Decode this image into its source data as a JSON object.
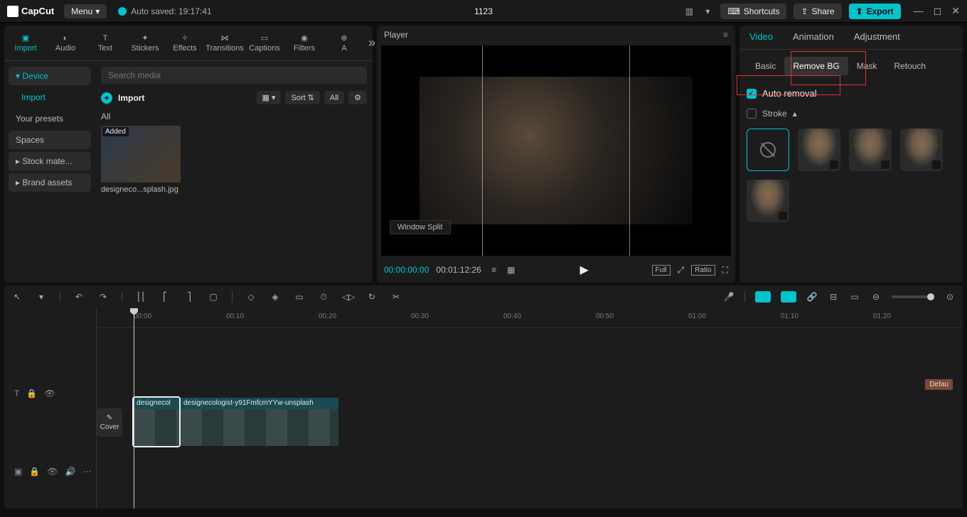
{
  "app": {
    "name": "CapCut",
    "menu": "Menu",
    "autosave": "Auto saved: 19:17:41",
    "project": "1123"
  },
  "topbuttons": {
    "shortcuts": "Shortcuts",
    "share": "Share",
    "export": "Export"
  },
  "mediaTabs": [
    "Import",
    "Audio",
    "Text",
    "Stickers",
    "Effects",
    "Transitions",
    "Captions",
    "Filters",
    "A"
  ],
  "sidebar": {
    "device": "Device",
    "import": "Import",
    "presets": "Your presets",
    "spaces": "Spaces",
    "stock": "Stock mate...",
    "brand": "Brand assets"
  },
  "mediaContent": {
    "searchPlaceholder": "Search media",
    "importLabel": "Import",
    "sort": "Sort",
    "all": "All",
    "allHeader": "All",
    "thumb": {
      "badge": "Added",
      "name": "designeco...splash.jpg"
    }
  },
  "player": {
    "title": "Player",
    "windowSplit": "Window Split",
    "timeCur": "00:00:00:00",
    "timeDur": "00:01:12:26",
    "full": "Full",
    "ratio": "Ratio"
  },
  "props": {
    "tabs": [
      "Video",
      "Animation",
      "Adjustment"
    ],
    "subtabs": [
      "Basic",
      "Remove BG",
      "Mask",
      "Retouch"
    ],
    "autoRemoval": "Auto removal",
    "stroke": "Stroke"
  },
  "timeline": {
    "cover": "Cover",
    "ticks": [
      "00:00",
      "00:10",
      "00:20",
      "00:30",
      "00:40",
      "00:50",
      "01:00",
      "01:10",
      "01:20"
    ],
    "clip1": "designecol",
    "clip2": "designecologist-y91FmfcmYYw-unsplash",
    "defaultTag": "Defau"
  }
}
